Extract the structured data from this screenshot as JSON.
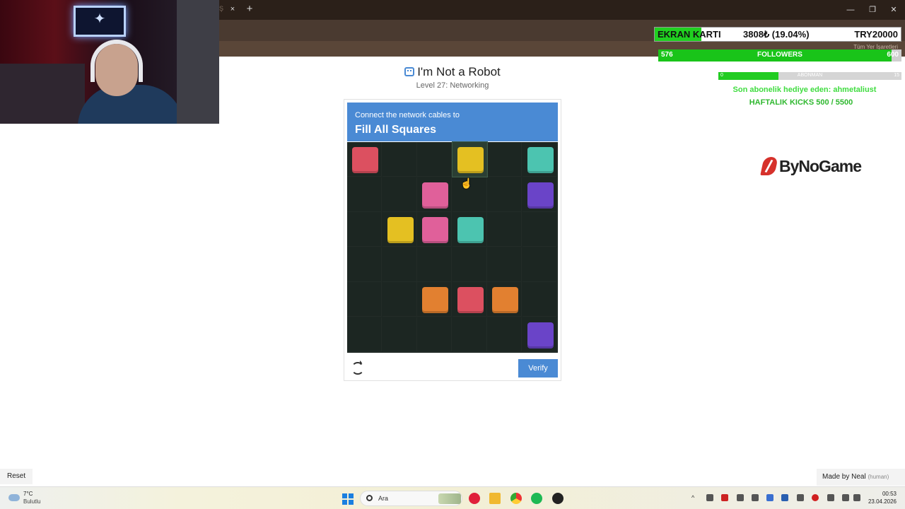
{
  "browser": {
    "tab_close": "×",
    "tab_new": "+",
    "tab_ghost": "Ş",
    "bookmarks_all": "Tüm Yer İşaretleri",
    "win_min": "—",
    "win_max": "❐",
    "win_close": "✕"
  },
  "overlay": {
    "ekran_title": "EKRAN KARTI",
    "ekran_amount": "3808₺ (19.04%)",
    "ekran_target": "TRY20000",
    "ekran_progress": 0.1904,
    "followers_current": "576",
    "followers_label": "FOLLOWERS",
    "followers_goal": "600",
    "followers_progress": 0.96,
    "abonman_current": "0",
    "abonman_label": "ABONMAN",
    "abonman_goal": "15",
    "abonman_progress": 0.33,
    "gift_text": "Son abonelik hediye eden: ahmetaliust",
    "kicks_text": "HAFTALIK KICKS 500 / 5500",
    "brand": "ByNoGame"
  },
  "captcha": {
    "title": "I'm Not a Robot",
    "subtitle": "Level 27: Networking",
    "instruction": "Connect the network cables to",
    "goal": "Fill All Squares",
    "verify_label": "Verify",
    "colors": {
      "red": "#dc5060",
      "yellow": "#e4c022",
      "teal": "#4cc4b0",
      "pink": "#e0609a",
      "purple": "#6a44c8",
      "orange": "#e28030",
      "accent": "#4a8ad4"
    },
    "grid": [
      [
        "red",
        null,
        null,
        "yellow",
        null,
        "teal"
      ],
      [
        null,
        null,
        "pink",
        null,
        null,
        "purple"
      ],
      [
        null,
        "yellow",
        "pink",
        "teal",
        null,
        null
      ],
      [
        null,
        null,
        null,
        null,
        null,
        null
      ],
      [
        null,
        null,
        "orange",
        "red",
        "orange",
        null
      ],
      [
        null,
        null,
        null,
        null,
        null,
        "purple"
      ]
    ],
    "selected_cell": [
      0,
      3
    ]
  },
  "page": {
    "reset_label": "Reset",
    "madeby_label": "Made by Neal",
    "madeby_human": "(human)"
  },
  "taskbar": {
    "temperature": "7°C",
    "weather": "Bulutlu",
    "search_placeholder": "Ara",
    "time": "00:53",
    "date": "23.04.2026"
  }
}
